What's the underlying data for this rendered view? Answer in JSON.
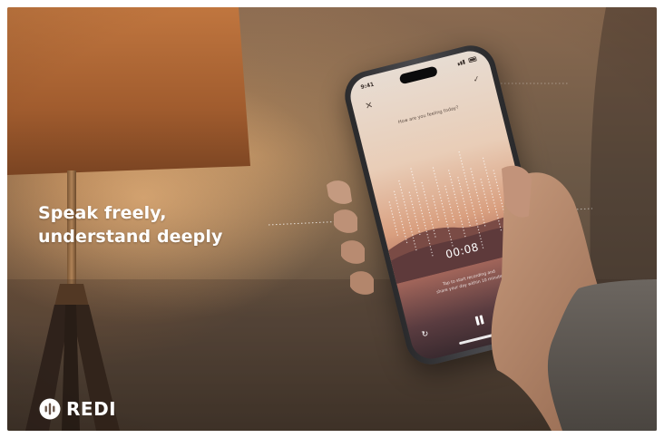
{
  "headline": {
    "line1": "Speak freely,",
    "line2": "understand deeply"
  },
  "brand": {
    "name": "REDI",
    "icon": "sound-wave-circle-icon"
  },
  "phone": {
    "status_time": "9:41",
    "prompt": "How are you feeling today?",
    "timer": "00:08",
    "hint_line1": "Tap to start recording and",
    "hint_line2": "share your day within 10 minutes",
    "icons": {
      "close": "close-icon",
      "confirm": "check-icon",
      "restart": "restart-icon",
      "pause": "pause-icon",
      "shuffle": "shuffle-icon"
    }
  },
  "colors": {
    "headline_text": "#ffffff",
    "screen_top": "#e7dcd2",
    "screen_mid": "#d99f7f",
    "screen_bottom": "#3a2a2f"
  }
}
